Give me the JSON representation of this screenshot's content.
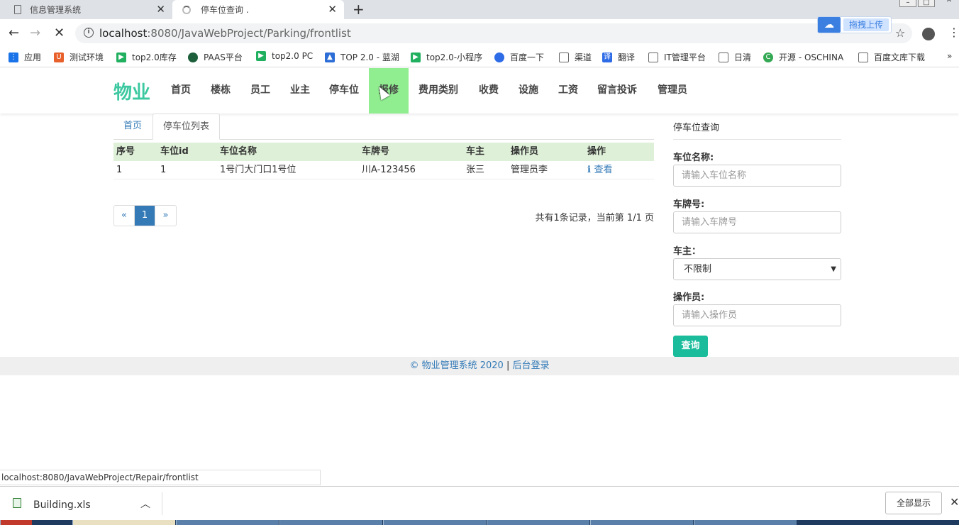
{
  "browser": {
    "tabs": [
      {
        "title": "信息管理系统"
      },
      {
        "title": "停车位查询  ."
      }
    ],
    "url_host": "localhost",
    "url_rest": ":8080/JavaWebProject/Parking/frontlist",
    "upload_label": "拖拽上传",
    "bookmarks": [
      "应用",
      "测试环境",
      "top2.0库存",
      "PAAS平台",
      "top2.0 PC",
      "TOP 2.0 - 蓝湖",
      "top2.0-小程序",
      "百度一下",
      "渠道",
      "翻译",
      "IT管理平台",
      "日清",
      "开源 - OSCHINA",
      "百度文库下载"
    ],
    "bookmarks_more": "»"
  },
  "navbar": {
    "brand": "物业",
    "items": [
      "首页",
      "楼栋",
      "员工",
      "业主",
      "停车位",
      "报修",
      "费用类别",
      "收费",
      "设施",
      "工资",
      "留言投诉",
      "管理员"
    ],
    "active": "报修"
  },
  "breadcrumb": {
    "home": "首页",
    "current": "停车位列表"
  },
  "table": {
    "headers": [
      "序号",
      "车位id",
      "车位名称",
      "车牌号",
      "车主",
      "操作员",
      "操作"
    ],
    "rows": [
      {
        "seq": "1",
        "id": "1",
        "name": "1号门大门口1号位",
        "plate": "川A-123456",
        "owner": "张三",
        "operator": "管理员李",
        "action": "查看"
      }
    ]
  },
  "pagination": {
    "prev": "«",
    "current": "1",
    "next": "»",
    "info": "共有1条记录，当前第 1/1 页"
  },
  "sidebar": {
    "title": "停车位查询",
    "fields": {
      "name_label": "车位名称:",
      "name_placeholder": "请输入车位名称",
      "plate_label": "车牌号:",
      "plate_placeholder": "请输入车牌号",
      "owner_label": "车主：",
      "owner_value": "不限制",
      "operator_label": "操作员:",
      "operator_placeholder": "请输入操作员"
    },
    "search_button": "查询"
  },
  "footer": {
    "copyright": "© 物业管理系统 2020",
    "sep": "|",
    "admin_link": "后台登录"
  },
  "statusbar": {
    "url": "localhost:8080/JavaWebProject/Repair/frontlist"
  },
  "downloads": {
    "file": "Building.xls",
    "show_all": "全部显示"
  },
  "colors": {
    "brand": "#3cc8a0",
    "active_nav": "#90ee90",
    "table_header": "#dff0d8",
    "primary": "#337ab7",
    "search_button": "#1abc9c"
  }
}
